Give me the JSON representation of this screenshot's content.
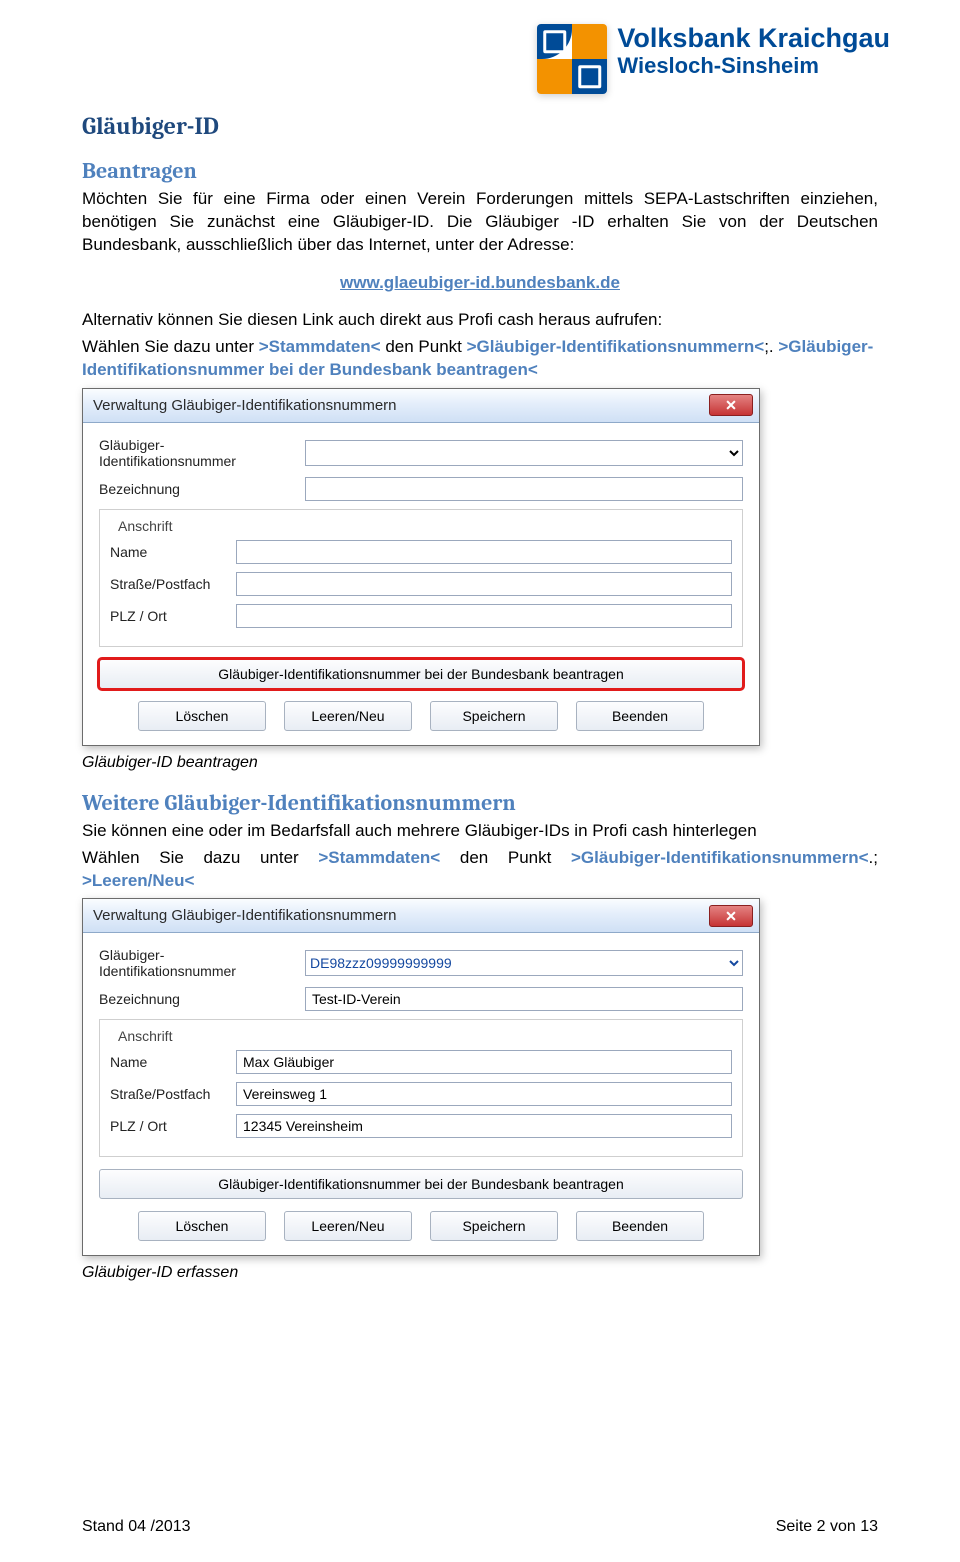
{
  "brand": {
    "line1": "Volksbank Kraichgau",
    "line2": "Wiesloch-Sinsheim"
  },
  "heading_main": "Gläubiger-ID",
  "heading_apply": "Beantragen",
  "para_apply": "Möchten Sie für eine Firma oder einen Verein Forderungen mittels SEPA-Lastschriften einziehen, benötigen Sie zunächst eine Gläubiger-ID. Die Gläubiger -ID erhalten Sie von der Deutschen Bundesbank, ausschließlich über das Internet, unter der Adresse:",
  "link_url": "www.glaeubiger-id.bundesbank.de",
  "para_alt": "Alternativ können Sie diesen Link auch direkt aus Profi cash heraus aufrufen:",
  "para_nav1_plain": "Wählen Sie dazu unter ",
  "para_nav1_a": ">Stammdaten<",
  "para_nav1_mid": " den Punkt ",
  "para_nav1_b": ">Gläubiger-Identifikationsnummern<",
  "para_nav1_tail": ";. ",
  "para_nav1_c": ">Gläubiger-Identifikationsnummer bei der Bundesbank beantragen<",
  "caption_dialog1": "Gläubiger-ID beantragen",
  "heading_more": "Weitere Gläubiger-Identifikationsnummern",
  "para_more": "Sie können eine oder im Bedarfsfall auch mehrere Gläubiger-IDs in Profi cash hinterlegen",
  "para_nav2_plain": "Wählen Sie dazu unter ",
  "para_nav2_a": ">Stammdaten<",
  "para_nav2_mid": " den Punkt ",
  "para_nav2_b": ">Gläubiger-Identifikationsnummern<",
  "para_nav2_tail": ".; ",
  "para_nav2_c": ">Leeren/Neu<",
  "caption_dialog2": "Gläubiger-ID erfassen",
  "footer": {
    "left": "Stand 04 /2013",
    "right": "Seite 2 von 13"
  },
  "dialog": {
    "title": "Verwaltung Gläubiger-Identifikationsnummern",
    "labels": {
      "id": "Gläubiger-Identifikationsnummer",
      "bez": "Bezeichnung",
      "anschrift": "Anschrift",
      "name": "Name",
      "strasse": "Straße/Postfach",
      "plzort": "PLZ / Ort"
    },
    "big_button": "Gläubiger-Identifikationsnummer bei der Bundesbank beantragen",
    "buttons": {
      "loeschen": "Löschen",
      "leeren": "Leeren/Neu",
      "speichern": "Speichern",
      "beenden": "Beenden"
    }
  },
  "dialog2_values": {
    "id": "DE98zzz09999999999",
    "bez": "Test-ID-Verein",
    "name": "Max Gläubiger",
    "strasse": "Vereinsweg 1",
    "plzort": "12345 Vereinsheim"
  }
}
